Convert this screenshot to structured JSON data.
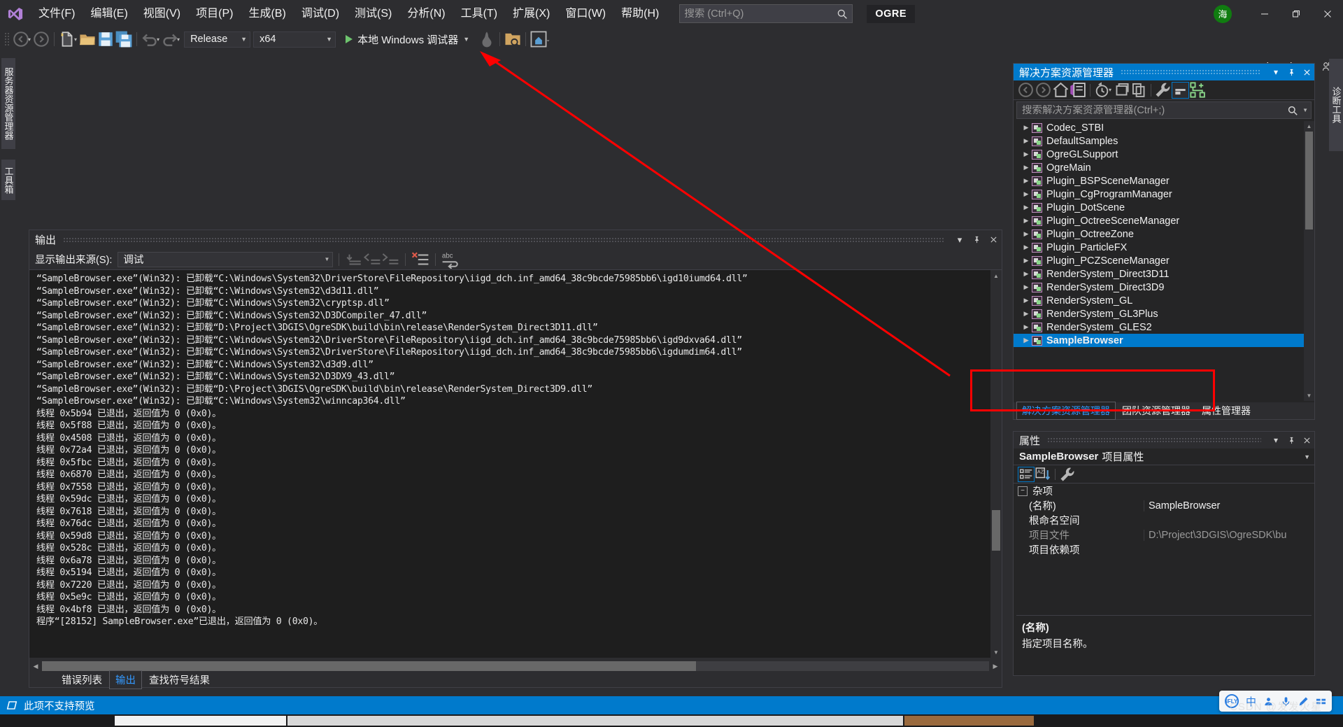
{
  "window": {
    "app_title": "Visual Studio",
    "ogre_badge": "OGRE",
    "avatar_initial": "海"
  },
  "menubar": {
    "items": [
      {
        "label": "文件(F)",
        "name": "menu-file"
      },
      {
        "label": "编辑(E)",
        "name": "menu-edit"
      },
      {
        "label": "视图(V)",
        "name": "menu-view"
      },
      {
        "label": "项目(P)",
        "name": "menu-project"
      },
      {
        "label": "生成(B)",
        "name": "menu-build"
      },
      {
        "label": "调试(D)",
        "name": "menu-debug"
      },
      {
        "label": "测试(S)",
        "name": "menu-test"
      },
      {
        "label": "分析(N)",
        "name": "menu-analyze"
      },
      {
        "label": "工具(T)",
        "name": "menu-tools"
      },
      {
        "label": "扩展(X)",
        "name": "menu-extensions"
      },
      {
        "label": "窗口(W)",
        "name": "menu-window"
      },
      {
        "label": "帮助(H)",
        "name": "menu-help"
      }
    ],
    "quick_launch_placeholder": "搜索 (Ctrl+Q)",
    "quick_launch_value": ""
  },
  "toolbar": {
    "configuration": "Release",
    "platform": "x64",
    "debug_target": "本地 Windows 调试器",
    "live_share": "Live Share"
  },
  "left_tool_tabs": [
    {
      "label": "服务器资源管理器",
      "name": "vtab-server-explorer"
    },
    {
      "label": "工具箱",
      "name": "vtab-toolbox"
    }
  ],
  "right_tool_tabs": [
    {
      "label": "诊断工具",
      "name": "vtab-diagnostic-tools"
    }
  ],
  "output_panel": {
    "title": "输出",
    "source_label": "显示输出来源(S):",
    "source_value": "调试",
    "lines": [
      "“SampleBrowser.exe”(Win32): 已卸载“C:\\Windows\\System32\\DriverStore\\FileRepository\\iigd_dch.inf_amd64_38c9bcde75985bb6\\igd10iumd64.dll”",
      "“SampleBrowser.exe”(Win32): 已卸载“C:\\Windows\\System32\\d3d11.dll”",
      "“SampleBrowser.exe”(Win32): 已卸载“C:\\Windows\\System32\\cryptsp.dll”",
      "“SampleBrowser.exe”(Win32): 已卸载“C:\\Windows\\System32\\D3DCompiler_47.dll”",
      "“SampleBrowser.exe”(Win32): 已卸载“D:\\Project\\3DGIS\\OgreSDK\\build\\bin\\release\\RenderSystem_Direct3D11.dll”",
      "“SampleBrowser.exe”(Win32): 已卸载“C:\\Windows\\System32\\DriverStore\\FileRepository\\iigd_dch.inf_amd64_38c9bcde75985bb6\\igd9dxva64.dll”",
      "“SampleBrowser.exe”(Win32): 已卸载“C:\\Windows\\System32\\DriverStore\\FileRepository\\iigd_dch.inf_amd64_38c9bcde75985bb6\\igdumdim64.dll”",
      "“SampleBrowser.exe”(Win32): 已卸载“C:\\Windows\\System32\\d3d9.dll”",
      "“SampleBrowser.exe”(Win32): 已卸载“C:\\Windows\\System32\\D3DX9_43.dll”",
      "“SampleBrowser.exe”(Win32): 已卸载“D:\\Project\\3DGIS\\OgreSDK\\build\\bin\\release\\RenderSystem_Direct3D9.dll”",
      "“SampleBrowser.exe”(Win32): 已卸载“C:\\Windows\\System32\\winncap364.dll”",
      "线程 0x5b94 已退出，返回值为 0 (0x0)。",
      "线程 0x5f88 已退出，返回值为 0 (0x0)。",
      "线程 0x4508 已退出，返回值为 0 (0x0)。",
      "线程 0x72a4 已退出，返回值为 0 (0x0)。",
      "线程 0x5fbc 已退出，返回值为 0 (0x0)。",
      "线程 0x6870 已退出，返回值为 0 (0x0)。",
      "线程 0x7558 已退出，返回值为 0 (0x0)。",
      "线程 0x59dc 已退出，返回值为 0 (0x0)。",
      "线程 0x7618 已退出，返回值为 0 (0x0)。",
      "线程 0x76dc 已退出，返回值为 0 (0x0)。",
      "线程 0x59d8 已退出，返回值为 0 (0x0)。",
      "线程 0x528c 已退出，返回值为 0 (0x0)。",
      "线程 0x6a78 已退出，返回值为 0 (0x0)。",
      "线程 0x5194 已退出，返回值为 0 (0x0)。",
      "线程 0x7220 已退出，返回值为 0 (0x0)。",
      "线程 0x5e9c 已退出，返回值为 0 (0x0)。",
      "线程 0x4bf8 已退出，返回值为 0 (0x0)。",
      "程序“[28152] SampleBrowser.exe”已退出，返回值为 0 (0x0)。"
    ],
    "tabs": [
      {
        "label": "错误列表",
        "active": false,
        "name": "tab-error-list"
      },
      {
        "label": "输出",
        "active": true,
        "name": "tab-output"
      },
      {
        "label": "查找符号结果",
        "active": false,
        "name": "tab-find-symbol-results"
      }
    ]
  },
  "solution_explorer": {
    "title": "解决方案资源管理器",
    "search_placeholder": "搜索解决方案资源管理器(Ctrl+;)",
    "search_value": "",
    "items": [
      {
        "label": "Codec_STBI",
        "selected": false
      },
      {
        "label": "DefaultSamples",
        "selected": false
      },
      {
        "label": "OgreGLSupport",
        "selected": false
      },
      {
        "label": "OgreMain",
        "selected": false
      },
      {
        "label": "Plugin_BSPSceneManager",
        "selected": false
      },
      {
        "label": "Plugin_CgProgramManager",
        "selected": false
      },
      {
        "label": "Plugin_DotScene",
        "selected": false
      },
      {
        "label": "Plugin_OctreeSceneManager",
        "selected": false
      },
      {
        "label": "Plugin_OctreeZone",
        "selected": false
      },
      {
        "label": "Plugin_ParticleFX",
        "selected": false
      },
      {
        "label": "Plugin_PCZSceneManager",
        "selected": false
      },
      {
        "label": "RenderSystem_Direct3D11",
        "selected": false
      },
      {
        "label": "RenderSystem_Direct3D9",
        "selected": false
      },
      {
        "label": "RenderSystem_GL",
        "selected": false
      },
      {
        "label": "RenderSystem_GL3Plus",
        "selected": false
      },
      {
        "label": "RenderSystem_GLES2",
        "selected": false
      },
      {
        "label": "SampleBrowser",
        "selected": true
      }
    ],
    "tabs": [
      {
        "label": "解决方案资源管理器",
        "active": true,
        "name": "tab-solution-explorer"
      },
      {
        "label": "团队资源管理器",
        "active": false,
        "name": "tab-team-explorer"
      },
      {
        "label": "属性管理器",
        "active": false,
        "name": "tab-property-manager"
      }
    ]
  },
  "properties_panel": {
    "title": "属性",
    "subject_bold": "SampleBrowser",
    "subject_rest": "项目属性",
    "category": "杂项",
    "rows": [
      {
        "key": "(名称)",
        "value": "SampleBrowser",
        "key_dim": false,
        "value_dim": false
      },
      {
        "key": "根命名空间",
        "value": "",
        "key_dim": false,
        "value_dim": false
      },
      {
        "key": "项目文件",
        "value": "D:\\Project\\3DGIS\\OgreSDK\\bu",
        "key_dim": true,
        "value_dim": true
      },
      {
        "key": "项目依赖项",
        "value": "",
        "key_dim": false,
        "value_dim": false
      }
    ],
    "description_title": "(名称)",
    "description_text": "指定项目名称。"
  },
  "statusbar": {
    "message": "此项不支持预览"
  },
  "ime": {
    "logo": "iFLY",
    "mode": "中"
  },
  "watermark": "CSDN @发发火星"
}
